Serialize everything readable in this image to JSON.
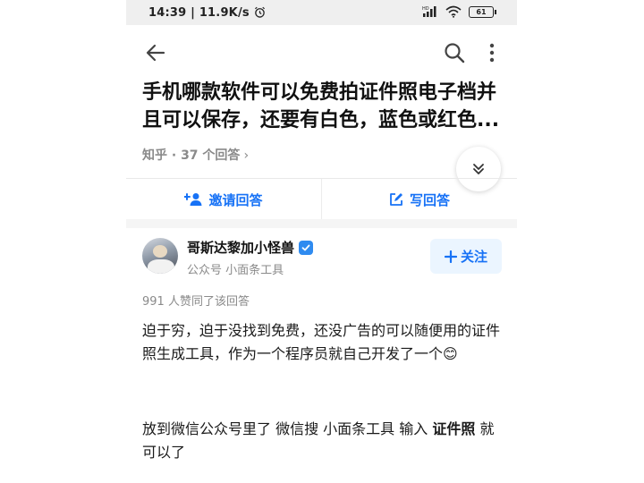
{
  "status_bar": {
    "time": "14:39",
    "speed": "11.9K/s",
    "battery": "61"
  },
  "question": {
    "title": "手机哪款软件可以免费拍证件照电子档并且可以保存，还要有白色，蓝色或红色...",
    "meta": "知乎 · 37 个回答",
    "meta_chevron": "›"
  },
  "actions": {
    "invite_label": "邀请回答",
    "write_label": "写回答"
  },
  "author": {
    "name": "哥斯达黎加小怪兽",
    "bio": "公众号 小面条工具",
    "follow_label": "关注"
  },
  "answer": {
    "likes": "991 人赞同了该回答",
    "paragraph1": "迫于穷，迫于没找到免费，还没广告的可以随便用的证件照生成工具，作为一个程序员就自己开发了一个😊",
    "paragraph2_prefix": "放到微信公众号里了 微信搜 小面条工具 输入 ",
    "paragraph2_bold": "证件照",
    "paragraph2_suffix": " 就可以了"
  },
  "icons": {
    "back": "arrow-left-icon",
    "search": "search-icon",
    "more": "more-vertical-icon",
    "expand": "double-chevron-down-icon",
    "invite": "add-user-icon",
    "write": "edit-icon",
    "verified": "verified-badge-icon",
    "follow": "plus-icon"
  },
  "colors": {
    "accent": "#1772f6",
    "muted": "#8a8a8a",
    "follow_bg": "#ebf5ff"
  }
}
